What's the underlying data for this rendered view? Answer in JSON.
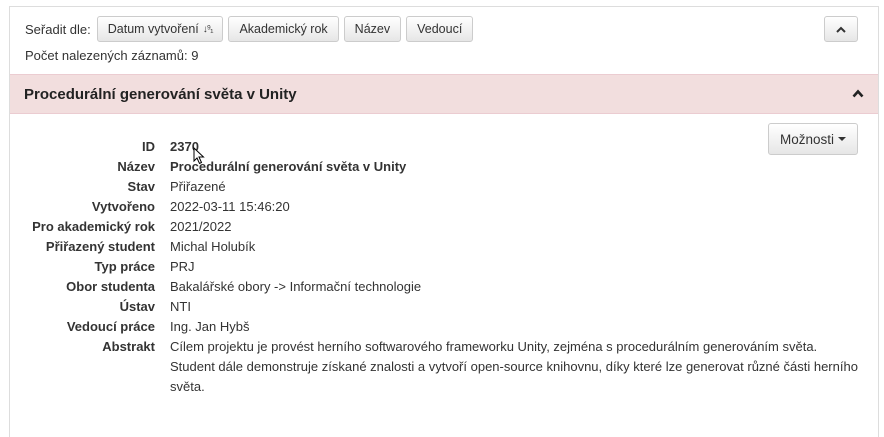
{
  "sort": {
    "label": "Seřadit dle:",
    "buttons": [
      {
        "label": "Datum vytvoření",
        "icon": "sort-numeric-desc-icon",
        "icon_glyph": "↓⁹₁"
      },
      {
        "label": "Akademický rok"
      },
      {
        "label": "Název"
      },
      {
        "label": "Vedoucí"
      }
    ]
  },
  "results": {
    "count_text": "Počet nalezených záznamů: 9"
  },
  "record": {
    "title": "Procedurální generování světa v Unity",
    "options_label": "Možnosti",
    "fields": [
      {
        "label": "ID",
        "value": "2370",
        "bold": true
      },
      {
        "label": "Název",
        "value": "Procedurální generování světa v Unity",
        "bold": true
      },
      {
        "label": "Stav",
        "value": "Přiřazené"
      },
      {
        "label": "Vytvořeno",
        "value": "2022-03-11 15:46:20"
      },
      {
        "label": "Pro akademický rok",
        "value": "2021/2022"
      },
      {
        "label": "Přiřazený student",
        "value": "Michal Holubík"
      },
      {
        "label": "Typ práce",
        "value": "PRJ"
      },
      {
        "label": "Obor studenta",
        "value": "Bakalářské obory -> Informační technologie"
      },
      {
        "label": "Ústav",
        "value": "NTI"
      },
      {
        "label": "Vedoucí práce",
        "value": "Ing. Jan Hybš"
      },
      {
        "label": "Abstrakt",
        "value": "Cílem projektu je provést herního softwarového frameworku Unity, zejména s procedurálním generováním světa. Student dále demonstruje získané znalosti a vytvoří open-source knihovnu, díky které lze generovat různé části herního světa."
      }
    ]
  },
  "colors": {
    "header_bg": "#f2dede",
    "header_border": "#ebccd1",
    "panel_border": "#dddddd"
  }
}
